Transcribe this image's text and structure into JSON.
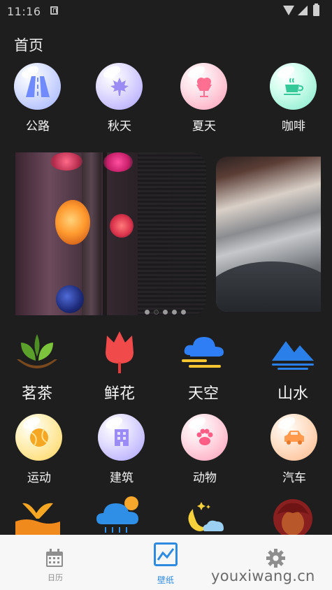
{
  "status_bar": {
    "time": "11:16"
  },
  "page": {
    "title": "首页"
  },
  "top_categories": [
    {
      "label": "公路",
      "icon": "road-icon"
    },
    {
      "label": "秋天",
      "icon": "maple-leaf-icon"
    },
    {
      "label": "夏天",
      "icon": "ice-cream-icon"
    },
    {
      "label": "咖啡",
      "icon": "coffee-cup-icon"
    }
  ],
  "banner": {
    "dot_count": 5,
    "active_dot": 1
  },
  "grid_categories": [
    {
      "label": "茗茶",
      "icon": "tea-leaves-icon"
    },
    {
      "label": "鲜花",
      "icon": "tulip-icon"
    },
    {
      "label": "天空",
      "icon": "cloud-icon"
    },
    {
      "label": "山水",
      "icon": "mountain-water-icon"
    },
    {
      "label": "运动",
      "icon": "tennis-ball-icon"
    },
    {
      "label": "建筑",
      "icon": "building-icon"
    },
    {
      "label": "动物",
      "icon": "paw-icon"
    },
    {
      "label": "汽车",
      "icon": "car-icon"
    }
  ],
  "partial_row_icons": [
    "whale-tail-icon",
    "rain-cloud-icon",
    "moon-night-icon",
    "girl-avatar-icon"
  ],
  "bottom_nav": [
    {
      "label": "日历",
      "icon": "calendar-icon"
    },
    {
      "label": "壁纸",
      "icon": "chart-icon"
    },
    {
      "label": "",
      "icon": "gear-icon"
    }
  ],
  "watermark": "youxiwang.cn",
  "colors": {
    "background": "#1e1e1e",
    "nav_active": "#2f8be0",
    "nav_bg": "#f7f7f7"
  }
}
